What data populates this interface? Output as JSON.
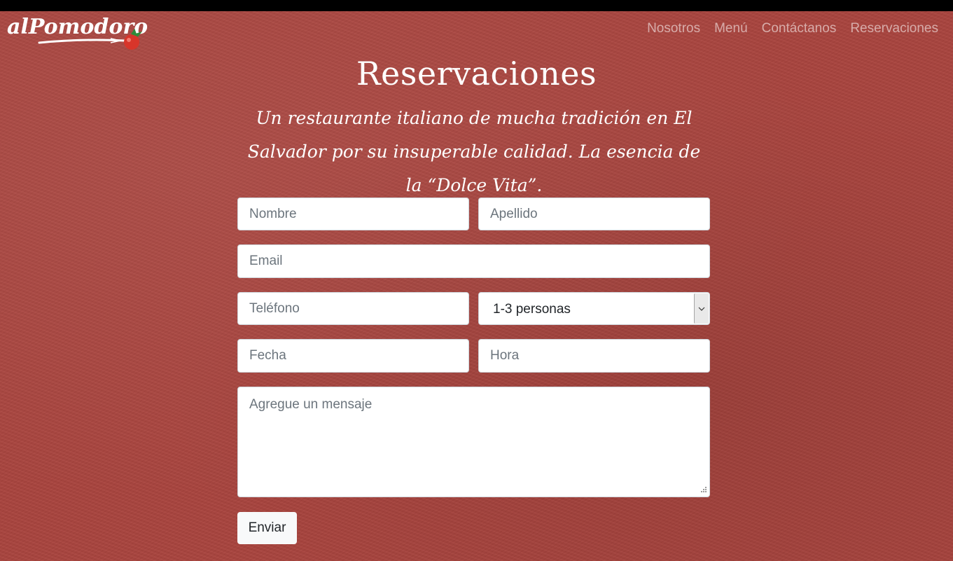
{
  "brand": {
    "logo_text": "alPomodoro"
  },
  "nav": {
    "items": [
      {
        "label": "Nosotros"
      },
      {
        "label": "Menú"
      },
      {
        "label": "Contáctanos"
      },
      {
        "label": "Reservaciones"
      }
    ]
  },
  "hero": {
    "title": "Reservaciones",
    "subtitle": "Un restaurante italiano de mucha tradición en El Salvador por su insuperable calidad. La esencia de la “Dolce Vita”."
  },
  "form": {
    "nombre_placeholder": "Nombre",
    "apellido_placeholder": "Apellido",
    "email_placeholder": "Email",
    "telefono_placeholder": "Teléfono",
    "personas_selected": "1-3 personas",
    "fecha_placeholder": "Fecha",
    "hora_placeholder": "Hora",
    "mensaje_placeholder": "Agregue un mensaje",
    "submit_label": "Enviar"
  },
  "colors": {
    "background": "#a8433d",
    "topbar": "#000000",
    "nav_text": "#d9a8a4",
    "tomato": "#d8352a"
  }
}
